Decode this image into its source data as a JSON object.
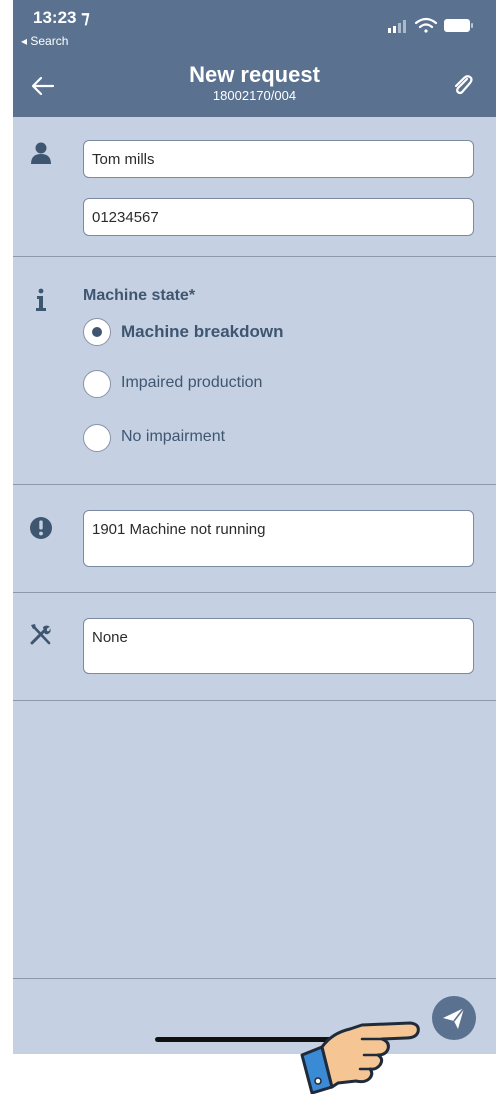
{
  "status_bar": {
    "time": "13:23 ⁊",
    "back_label": "◂ Search"
  },
  "nav": {
    "title": "New request",
    "subtitle": "18002170/004",
    "back_icon": "arrow-left-icon",
    "attach_icon": "paperclip-icon"
  },
  "contact": {
    "icon": "person-icon",
    "name_value": "Tom mills",
    "phone_value": "01234567"
  },
  "machine_state": {
    "icon": "info-icon",
    "label": "Machine state*",
    "options": [
      {
        "label": "Machine breakdown",
        "selected": true
      },
      {
        "label": "Impaired production",
        "selected": false
      },
      {
        "label": "No impairment",
        "selected": false
      }
    ]
  },
  "problem": {
    "icon": "exclamation-icon",
    "value": "1901 Machine not running"
  },
  "tools": {
    "icon": "tools-icon",
    "value": "None"
  },
  "footer": {
    "send_icon": "send-icon"
  },
  "colors": {
    "header": "#5a7190",
    "background": "#c5d1e3",
    "accent": "#3f5671"
  }
}
